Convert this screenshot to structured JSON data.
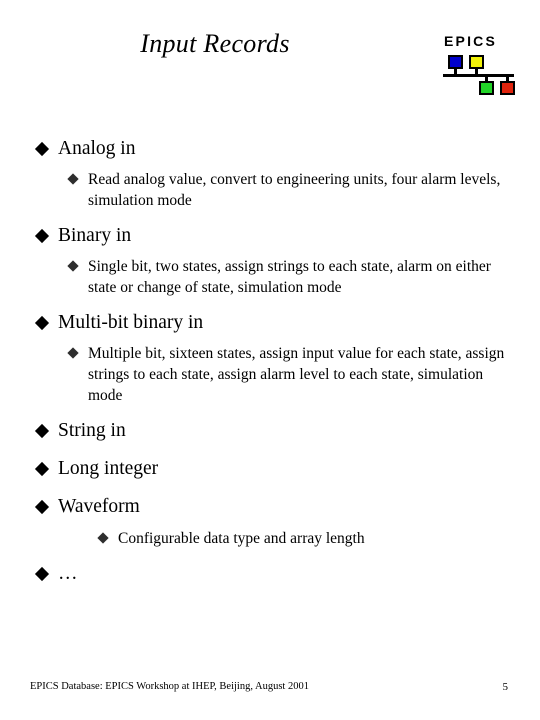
{
  "slide": {
    "title": "Input Records",
    "page_number": "5",
    "footer_text": "EPICS Database: EPICS Workshop at IHEP, Beijing, August 2001"
  },
  "logo": {
    "wordmark": "EPICS",
    "colors": {
      "blue": "#0000cc",
      "yellow": "#f2f20a",
      "green": "#22d428",
      "red": "#e0240d",
      "line": "#000000"
    }
  },
  "bullets": [
    {
      "level": 1,
      "text": "Analog in"
    },
    {
      "level": 2,
      "text": "Read analog value, convert to engineering units, four alarm levels, simulation mode"
    },
    {
      "level": 1,
      "text": "Binary in"
    },
    {
      "level": 2,
      "text": "Single bit, two states, assign strings to each state, alarm on either state or change of state, simulation mode"
    },
    {
      "level": 1,
      "text": "Multi-bit binary in"
    },
    {
      "level": 2,
      "text": "Multiple bit, sixteen states, assign input value for each state, assign strings to each state, assign alarm level to each state, simulation mode"
    },
    {
      "level": 1,
      "text": "String in"
    },
    {
      "level": 1,
      "text": "Long integer"
    },
    {
      "level": 1,
      "text": "Waveform"
    },
    {
      "level": 3,
      "text": "Configurable data type and array length"
    },
    {
      "level": 1,
      "text": "…"
    }
  ]
}
